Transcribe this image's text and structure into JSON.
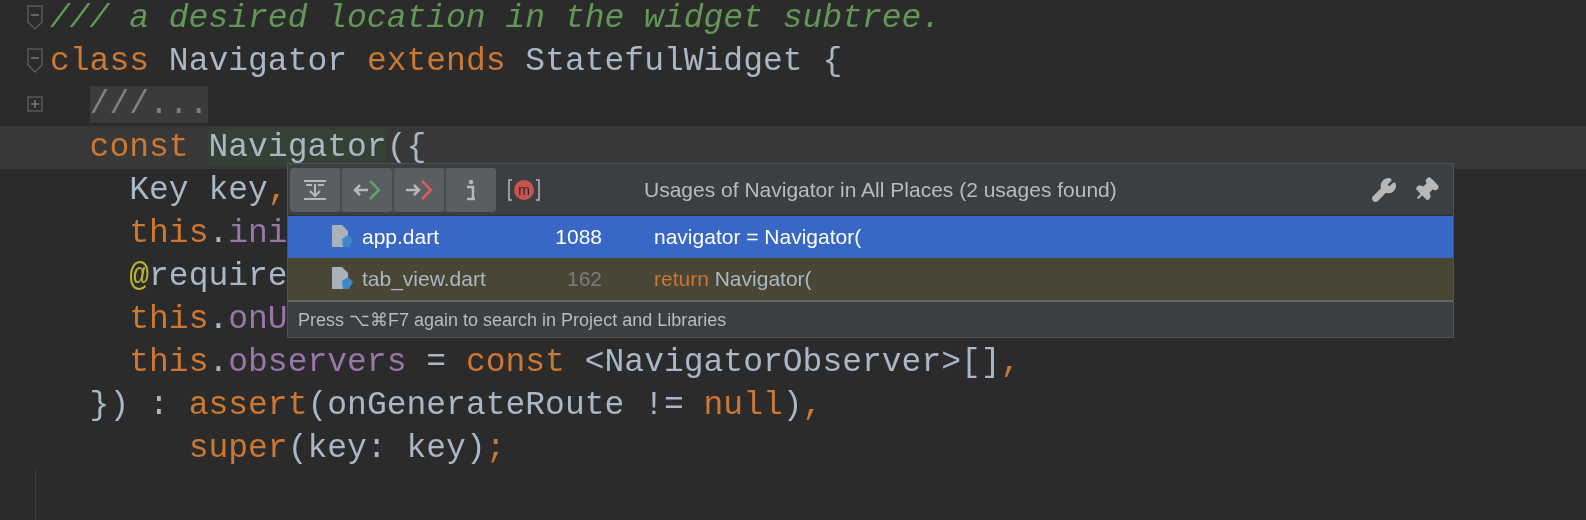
{
  "editor": {
    "lines": [
      {
        "kind": "fold-start",
        "current": false,
        "tokens": [
          {
            "kind": "comment",
            "text": "/// a desired location in the widget subtree."
          }
        ]
      },
      {
        "kind": "fold-start",
        "current": false,
        "tokens": [
          {
            "kind": "keyword",
            "text": "class"
          },
          {
            "kind": "plain",
            "text": " Navigator "
          },
          {
            "kind": "keyword",
            "text": "extends"
          },
          {
            "kind": "plain",
            "text": " StatefulWidget {"
          }
        ]
      },
      {
        "kind": "folded",
        "current": false,
        "tokens": [
          {
            "kind": "folded",
            "text": "  ///..."
          }
        ]
      },
      {
        "kind": "code",
        "current": true,
        "tokens": [
          {
            "kind": "keyword",
            "text": "  const "
          },
          {
            "kind": "usage",
            "text": "Navigator"
          },
          {
            "kind": "plain",
            "text": "({"
          }
        ]
      },
      {
        "kind": "code",
        "current": false,
        "tokens": [
          {
            "kind": "plain",
            "text": "    Key key"
          },
          {
            "kind": "keyword",
            "text": ","
          }
        ]
      },
      {
        "kind": "code",
        "current": false,
        "tokens": [
          {
            "kind": "keyword",
            "text": "    this"
          },
          {
            "kind": "plain",
            "text": "."
          },
          {
            "kind": "field",
            "text": "ini"
          }
        ]
      },
      {
        "kind": "code",
        "current": false,
        "tokens": [
          {
            "kind": "annotation",
            "text": "    @"
          },
          {
            "kind": "plain",
            "text": "require"
          }
        ]
      },
      {
        "kind": "code",
        "current": false,
        "tokens": [
          {
            "kind": "keyword",
            "text": "    this"
          },
          {
            "kind": "plain",
            "text": "."
          },
          {
            "kind": "field",
            "text": "onU"
          }
        ]
      },
      {
        "kind": "code",
        "current": false,
        "tokens": [
          {
            "kind": "keyword",
            "text": "    this"
          },
          {
            "kind": "plain",
            "text": "."
          },
          {
            "kind": "field",
            "text": "observers"
          },
          {
            "kind": "plain",
            "text": " = "
          },
          {
            "kind": "keyword",
            "text": "const"
          },
          {
            "kind": "plain",
            "text": " <NavigatorObserver>[]"
          },
          {
            "kind": "keyword",
            "text": ","
          }
        ]
      },
      {
        "kind": "code",
        "current": false,
        "tokens": [
          {
            "kind": "plain",
            "text": "  }) : "
          },
          {
            "kind": "keyword",
            "text": "assert"
          },
          {
            "kind": "plain",
            "text": "(onGenerateRoute != "
          },
          {
            "kind": "keyword",
            "text": "null"
          },
          {
            "kind": "plain",
            "text": ")"
          },
          {
            "kind": "keyword",
            "text": ","
          }
        ]
      },
      {
        "kind": "code",
        "current": false,
        "tokens": [
          {
            "kind": "keyword",
            "text": "       super"
          },
          {
            "kind": "plain",
            "text": "(key: key)"
          },
          {
            "kind": "keyword",
            "text": ";"
          }
        ]
      }
    ]
  },
  "usages_popup": {
    "filter_letter": "m",
    "title": "Usages of Navigator in All Places (2 usages found)",
    "rows": [
      {
        "file": "app.dart",
        "line": "1088",
        "selected": true,
        "code": [
          {
            "kind": "plain",
            "text": "navigator = Navigator("
          }
        ]
      },
      {
        "file": "tab_view.dart",
        "line": "162",
        "selected": false,
        "code": [
          {
            "kind": "keyword",
            "text": "return"
          },
          {
            "kind": "plain",
            "text": " Navigator("
          }
        ]
      }
    ],
    "hint": "Press ⌥⌘F7 again to search in Project and Libraries"
  }
}
